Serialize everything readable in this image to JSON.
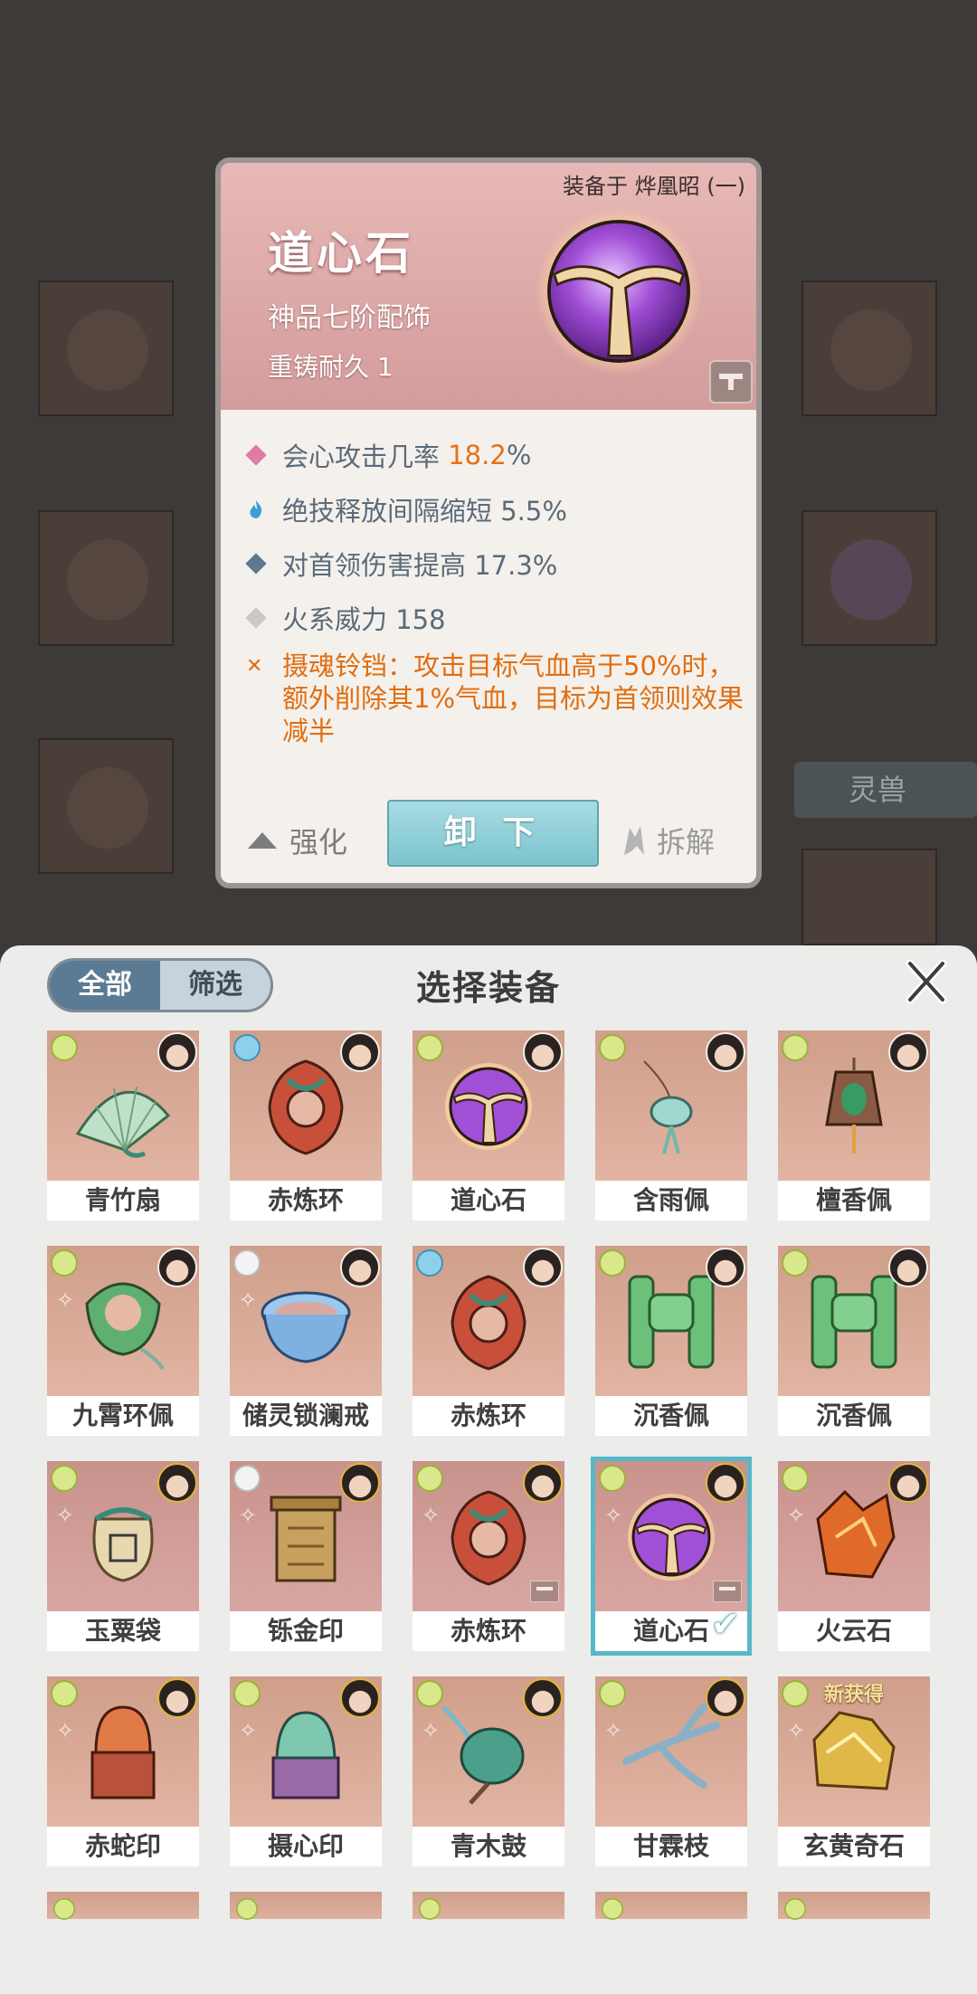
{
  "detail_card": {
    "equipped_on": "装备于 烨凰昭 (一)",
    "name": "道心石",
    "grade": "神品七阶配饰",
    "durability": "重铸耐久 1",
    "stats": [
      {
        "label": "会心攻击几率",
        "value": "18.2",
        "suffix": "%",
        "color": "#e57018",
        "icon": "pink-diamond-icon"
      },
      {
        "label": "绝技释放间隔缩短 5.5%",
        "icon": "flame-icon"
      },
      {
        "label": "对首领伤害提高 17.3%",
        "icon": "blue-diamond-icon"
      },
      {
        "label": "火系威力 158",
        "icon": "grey-diamond-icon"
      }
    ],
    "effect_text": "摄魂铃铛：攻击目标气血高于50%时，额外削除其1%气血，目标为首领则效果减半",
    "strengthen_label": "强化",
    "unequip_label": "卸 下",
    "dismantle_label": "拆解"
  },
  "background": {
    "tag_label": "灵兽"
  },
  "panel": {
    "filter_all": "全部",
    "filter_select": "筛选",
    "title": "选择装备",
    "close_icon": "close-icon"
  },
  "items": [
    {
      "name": "青竹扇",
      "element": "green",
      "art": "fan"
    },
    {
      "name": "赤炼环",
      "element": "blue",
      "art": "ring-red"
    },
    {
      "name": "道心石",
      "element": "green",
      "art": "orb"
    },
    {
      "name": "含雨佩",
      "element": "green",
      "art": "pendant"
    },
    {
      "name": "檀香佩",
      "element": "green",
      "art": "pendant-brown"
    },
    {
      "name": "九霄环佩",
      "element": "green",
      "art": "ring-green"
    },
    {
      "name": "储灵锁澜戒",
      "element": "white",
      "art": "bracelet"
    },
    {
      "name": "赤炼环",
      "element": "blue",
      "art": "ring-red"
    },
    {
      "name": "沉香佩",
      "element": "green",
      "art": "jade"
    },
    {
      "name": "沉香佩",
      "element": "green",
      "art": "jade"
    },
    {
      "name": "玉粟袋",
      "element": "green",
      "art": "bag",
      "locked": false
    },
    {
      "name": "铄金印",
      "element": "white",
      "art": "seal-gold"
    },
    {
      "name": "赤炼环",
      "element": "green",
      "art": "ring-red",
      "locked": true
    },
    {
      "name": "道心石",
      "element": "green",
      "art": "orb",
      "locked": true,
      "selected": true
    },
    {
      "name": "火云石",
      "element": "green",
      "art": "fire-stone"
    },
    {
      "name": "赤蛇印",
      "element": "green",
      "art": "seal-red"
    },
    {
      "name": "摄心印",
      "element": "green",
      "art": "seal-purple"
    },
    {
      "name": "青木鼓",
      "element": "green",
      "art": "drum"
    },
    {
      "name": "甘霖枝",
      "element": "green",
      "art": "branch"
    },
    {
      "name": "玄黄奇石",
      "element": "green",
      "art": "gold-stone",
      "new_label": "新获得"
    }
  ]
}
